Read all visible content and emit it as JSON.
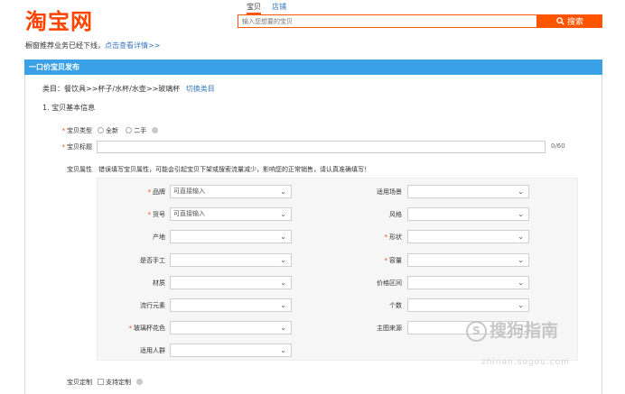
{
  "header": {
    "logo": "淘宝网",
    "tabs": [
      "宝贝",
      "店铺"
    ],
    "search_placeholder": "输入您想要的宝贝",
    "search_button": "搜索",
    "accent": "#ff5500"
  },
  "notice": {
    "text": "橱窗推荐业务已经下线，",
    "link": "点击查看详情>>"
  },
  "section": {
    "title": "一口价宝贝发布",
    "bar_color": "#3aa1e6",
    "category_label": "类目：",
    "category_path": "餐饮具>>杯子/水杯/水壶>>玻璃杯",
    "switch_link": "切换类目",
    "basic_info": "1. 宝贝基本信息"
  },
  "form": {
    "type_label": "宝贝类型",
    "type_options": [
      "全新",
      "二手"
    ],
    "title_label": "宝贝标题",
    "title_counter": "0/60",
    "attr_label": "宝贝属性",
    "attr_hint": "错误填写宝贝属性，可能会引起宝贝下架或搜索流量减少，影响您的正常销售，请认真准确填写！",
    "left_attrs": [
      {
        "label": "品牌",
        "required": true,
        "value": "可直接输入"
      },
      {
        "label": "货号",
        "required": true,
        "value": "可直接输入"
      },
      {
        "label": "产地",
        "required": false,
        "value": ""
      },
      {
        "label": "是否手工",
        "required": false,
        "value": ""
      },
      {
        "label": "材质",
        "required": false,
        "value": ""
      },
      {
        "label": "流行元素",
        "required": false,
        "value": ""
      },
      {
        "label": "玻璃杯花色",
        "required": true,
        "value": ""
      },
      {
        "label": "适用人群",
        "required": false,
        "value": ""
      }
    ],
    "right_attrs": [
      {
        "label": "适用场景",
        "required": false,
        "value": ""
      },
      {
        "label": "风格",
        "required": false,
        "value": ""
      },
      {
        "label": "形状",
        "required": true,
        "value": ""
      },
      {
        "label": "容量",
        "required": true,
        "value": ""
      },
      {
        "label": "价格区间",
        "required": false,
        "value": ""
      },
      {
        "label": "个数",
        "required": false,
        "value": ""
      },
      {
        "label": "主图来源",
        "required": false,
        "value": ""
      }
    ],
    "custom_label": "宝贝定制",
    "custom_option": "支持定制"
  },
  "watermark": {
    "text": "搜狗指南",
    "sub": "zhinan.sogou.com"
  }
}
